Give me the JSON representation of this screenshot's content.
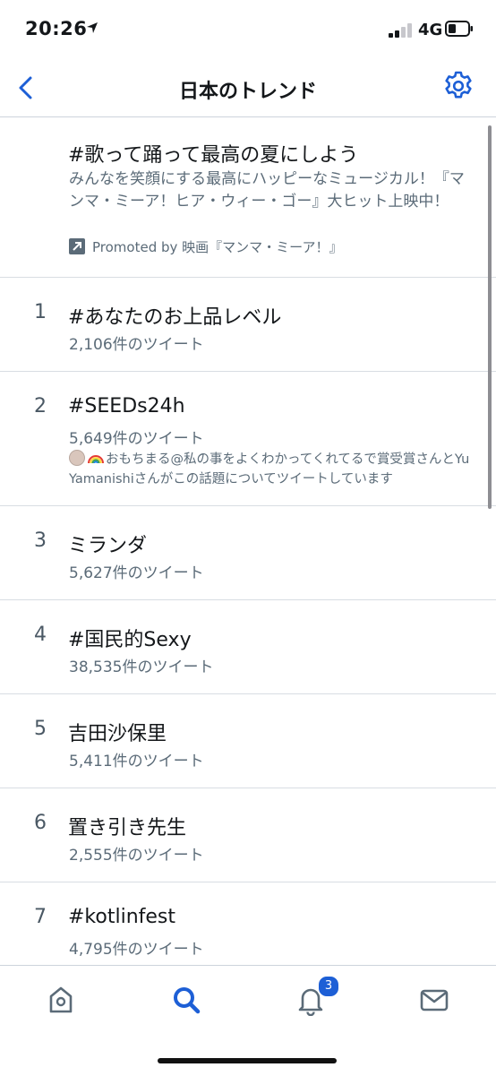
{
  "status": {
    "time": "20:26",
    "network": "4G"
  },
  "nav": {
    "title": "日本のトレンド"
  },
  "promoted": {
    "name": "#歌って踊って最高の夏にしよう",
    "description": "みんなを笑顔にする最高にハッピーなミュージカル！『マンマ・ミーア！ヒア・ウィー・ゴー』大ヒット上映中！",
    "promoted_by": "Promoted by 映画『マンマ・ミーア！』"
  },
  "trends": [
    {
      "rank": "1",
      "name": "#あなたのお上品レベル",
      "count": "2,106件のツイート"
    },
    {
      "rank": "2",
      "name": "#SEEDs24h",
      "count": "5,649件のツイート",
      "context": "おもちまる@私の事をよくわかってくれてるで賞受賞さんとYu Yamanishiさんがこの話題についてツイートしています"
    },
    {
      "rank": "3",
      "name": "ミランダ",
      "count": "5,627件のツイート"
    },
    {
      "rank": "4",
      "name": "#国民的Sexy",
      "count": "38,535件のツイート"
    },
    {
      "rank": "5",
      "name": "吉田沙保里",
      "count": "5,411件のツイート"
    },
    {
      "rank": "6",
      "name": "置き引き先生",
      "count": "2,555件のツイート"
    },
    {
      "rank": "7",
      "name": "#kotlinfest",
      "count": "4,795件のツイート"
    }
  ],
  "tabs": {
    "notification_badge": "3"
  },
  "icons": {
    "back": "chevron-left-icon",
    "settings": "gear-icon",
    "home": "home-icon",
    "search": "search-icon",
    "notifications": "bell-icon",
    "messages": "mail-icon"
  },
  "colors": {
    "accent": "#1d5fd6",
    "text": "#14171a",
    "secondary_text": "#5b6b78"
  }
}
